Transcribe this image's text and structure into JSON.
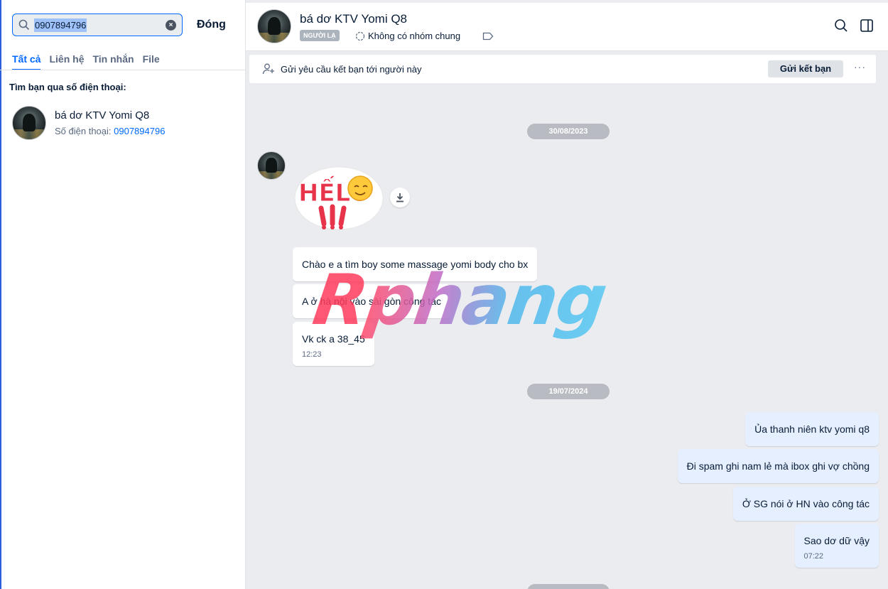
{
  "search": {
    "value": "0907894796",
    "close_label": "Đóng"
  },
  "tabs": [
    {
      "label": "Tất cả"
    },
    {
      "label": "Liên hệ"
    },
    {
      "label": "Tin nhắn"
    },
    {
      "label": "File"
    }
  ],
  "find_by_phone_label": "Tìm bạn qua số điện thoại:",
  "result": {
    "name": "bá dơ KTV Yomi Q8",
    "phone_label": "Số điện thoại:",
    "phone": "0907894796"
  },
  "chat": {
    "title": "bá dơ KTV Yomi Q8",
    "stranger_badge": "NGƯỜI LẠ",
    "common_groups": "Không có nhóm chung",
    "friend_request_text": "Gửi yêu cầu kết bạn tới người này",
    "friend_request_button": "Gửi kết bạn",
    "more": "···"
  },
  "dates": [
    "30/08/2023",
    "19/07/2024"
  ],
  "messages_in": [
    {
      "text": "Chào e a tìm boy some massage yomi body cho bx"
    },
    {
      "text": "A ở hà nội vào sài gòn công tác"
    },
    {
      "text": "Vk ck a 38_45",
      "time": "12:23"
    }
  ],
  "messages_out": [
    {
      "text": "Ủa thanh niên ktv yomi q8"
    },
    {
      "text": "Đi spam ghi nam lẻ mà ibox ghi vợ chồng"
    },
    {
      "text": "Ở SG nói ở HN vào công tác"
    },
    {
      "text": "Sao dơ dữ vậy",
      "time": "07:22"
    }
  ],
  "sticker_text": "HẾLÔ",
  "watermark": {
    "first": "R",
    "rest": "phang"
  },
  "icons": {
    "search": "search-icon",
    "clear": "clear-icon",
    "group": "group-icon",
    "tag": "tag-icon",
    "sidebar": "sidebar-toggle-icon",
    "add_friend": "add-friend-icon",
    "download": "download-icon"
  },
  "colors": {
    "accent": "#0068ff",
    "outgoing_bubble": "#e5efff",
    "chat_bg": "#ebecf0"
  }
}
